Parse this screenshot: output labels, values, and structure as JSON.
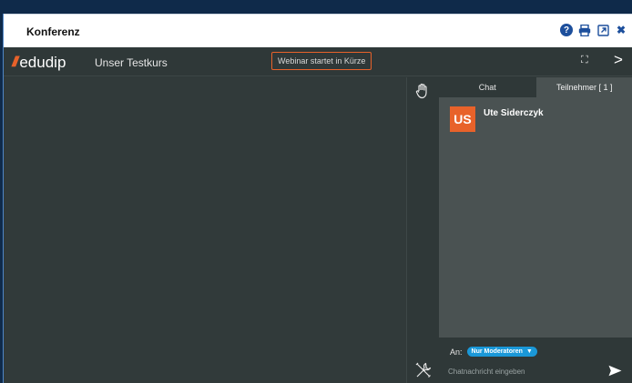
{
  "window": {
    "title": "Konferenz"
  },
  "header": {
    "logo_text": "edudip",
    "logo_mark": "///",
    "course_title": "Unser Testkurs",
    "webinar_status": "Webinar startet in Kürze",
    "expand_glyph": "⛶",
    "next_glyph": ">"
  },
  "panel": {
    "tabs": [
      {
        "label": "Chat"
      },
      {
        "label": "Teilnehmer [ 1 ]"
      }
    ],
    "participants": [
      {
        "initials": "US",
        "name": "Ute Siderczyk"
      }
    ],
    "composer": {
      "to_label": "An:",
      "recipient": "Nur Moderatoren",
      "placeholder": "Chatnachricht eingeben"
    }
  },
  "colors": {
    "accent": "#e8622a",
    "recipient_badge": "#1a98d8",
    "icon_blue": "#1d4f9c"
  }
}
